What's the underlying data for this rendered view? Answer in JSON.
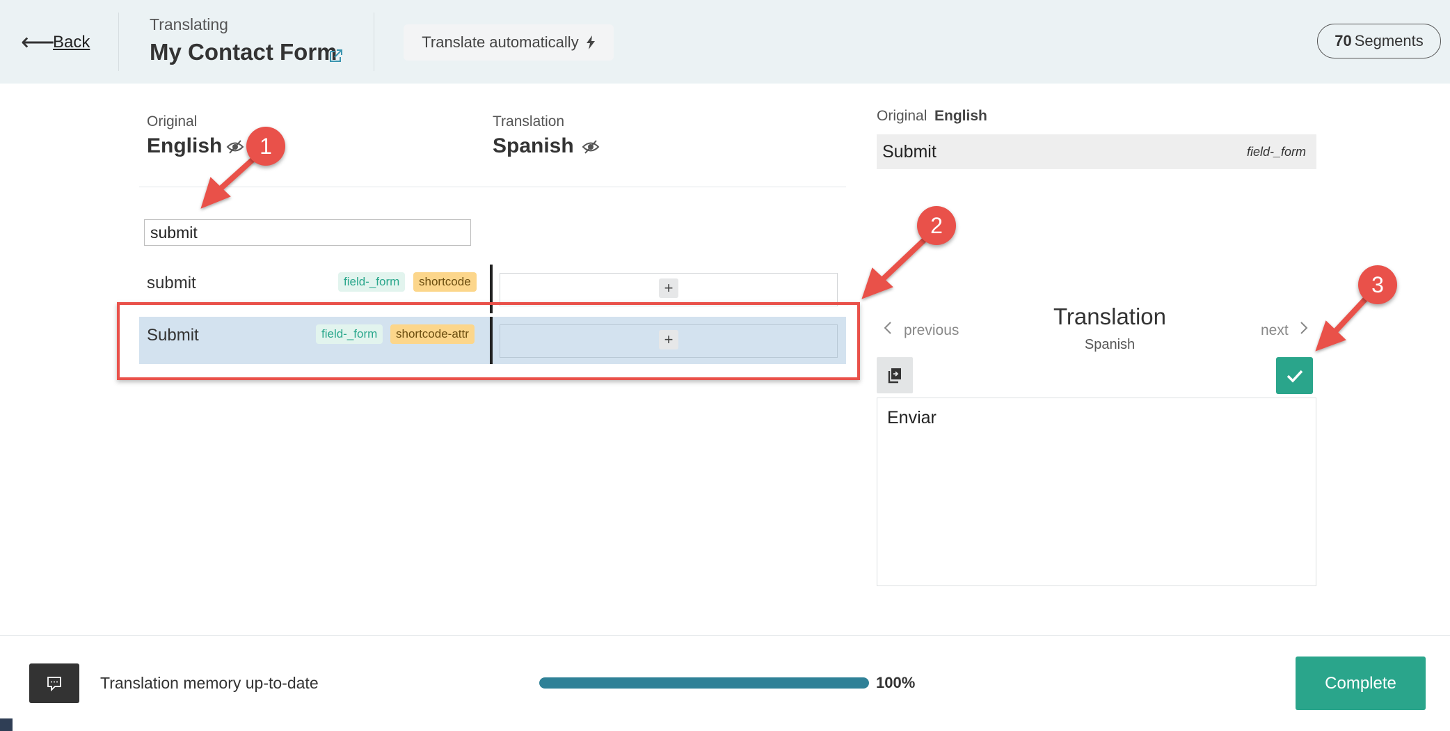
{
  "header": {
    "back_label": "Back",
    "job_kicker": "Translating",
    "job_title": "My Contact Form",
    "auto_translate_label": "Translate automatically",
    "segments_count": "70",
    "segments_label": "Segments"
  },
  "columns": {
    "original_kicker": "Original",
    "original_language": "English",
    "translation_kicker": "Translation",
    "translation_language": "Spanish"
  },
  "search": {
    "value": "submit"
  },
  "rows": [
    {
      "text": "submit",
      "tags": [
        "field-_form",
        "shortcode"
      ],
      "selected": false
    },
    {
      "text": "Submit",
      "tags": [
        "field-_form",
        "shortcode-attr"
      ],
      "selected": true
    }
  ],
  "right_panel": {
    "original_label": "Original",
    "original_language": "English",
    "source_text": "Submit",
    "source_tag": "field-_form",
    "previous_label": "previous",
    "title": "Translation",
    "subtitle": "Spanish",
    "next_label": "next",
    "translation_value": "Enviar"
  },
  "callouts": [
    "1",
    "2",
    "3"
  ],
  "footer": {
    "memory_status": "Translation memory up-to-date",
    "progress_percent": 100,
    "progress_label": "100%",
    "complete_label": "Complete"
  },
  "colors": {
    "accent_green": "#2aa58b",
    "progress_blue": "#2f8197",
    "annotation_red": "#e9514a",
    "selected_row": "#d3e2ef"
  },
  "icons": [
    "back-arrow-icon",
    "external-link-icon",
    "bolt-icon",
    "eye-off-icon",
    "plus-icon",
    "chevron-left-icon",
    "chevron-right-icon",
    "copy-icon",
    "check-icon",
    "chat-icon"
  ]
}
